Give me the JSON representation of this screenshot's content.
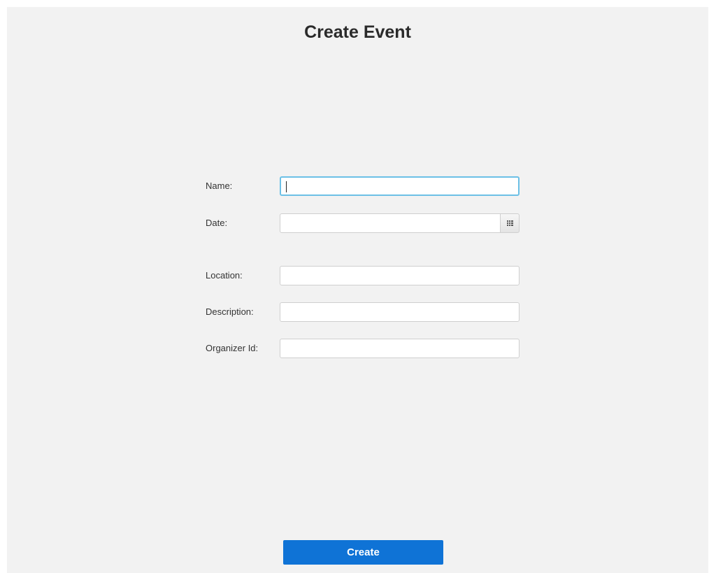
{
  "window": {
    "title": "Create Event"
  },
  "form": {
    "name": {
      "label": "Name:",
      "value": ""
    },
    "date": {
      "label": "Date:",
      "value": "",
      "picker_icon": "calendar-icon"
    },
    "location": {
      "label": "Location:",
      "value": ""
    },
    "description": {
      "label": "Description:",
      "value": ""
    },
    "organizer_id": {
      "label": "Organizer Id:",
      "value": ""
    }
  },
  "actions": {
    "create_label": "Create"
  },
  "colors": {
    "background": "#f2f2f2",
    "focus_border": "#6cc0e6",
    "primary_button": "#0f73d6"
  }
}
